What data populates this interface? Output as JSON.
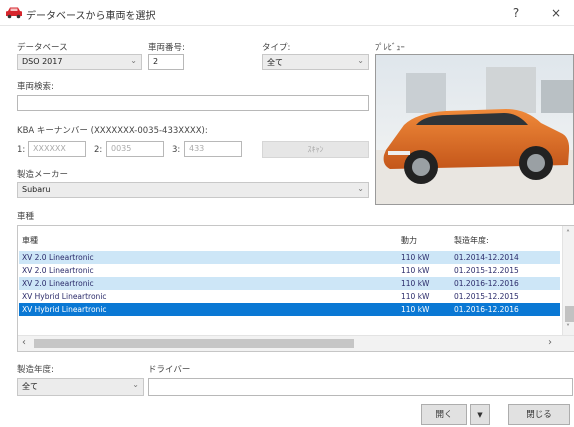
{
  "window": {
    "title": "データベースから車両を選択",
    "help_label": "?",
    "close_label": "×"
  },
  "form": {
    "database_label": "データベース",
    "database_value": "DSO 2017",
    "vehicle_no_label": "車両番号:",
    "vehicle_no_value": "2",
    "type_label": "タイプ:",
    "type_value": "全て",
    "search_label": "車両検索:",
    "search_value": "",
    "kba_label": "KBA キーナンバー (XXXXXXX-0035-433XXXX):",
    "kba_1_label": "1:",
    "kba_1_placeholder": "XXXXXX",
    "kba_2_label": "2:",
    "kba_2_value": "0035",
    "kba_3_label": "3:",
    "kba_3_value": "433",
    "kba_apply_label": "ｽｷｬﾝ",
    "manufacturer_label": "製造メーカー",
    "manufacturer_value": "Subaru",
    "preview_label": "ﾌﾟﾚﾋﾞｭｰ"
  },
  "models": {
    "section_label": "車種",
    "columns": [
      "車種",
      "動力",
      "製造年度:"
    ],
    "rows": [
      {
        "name": "XV 2.0 Lineartronic",
        "power": "110 kW",
        "years": "01.2014-12.2014",
        "state": "alt"
      },
      {
        "name": "XV 2.0 Lineartronic",
        "power": "110 kW",
        "years": "01.2015-12.2015",
        "state": "normal"
      },
      {
        "name": "XV 2.0 Lineartronic",
        "power": "110 kW",
        "years": "01.2016-12.2016",
        "state": "alt"
      },
      {
        "name": "XV Hybrid Lineartronic",
        "power": "110 kW",
        "years": "01.2015-12.2015",
        "state": "normal"
      },
      {
        "name": "XV Hybrid Lineartronic",
        "power": "110 kW",
        "years": "01.2016-12.2016",
        "state": "selected"
      }
    ]
  },
  "footer": {
    "year_label": "製造年度:",
    "year_value": "全て",
    "driver_label": "ドライバー",
    "driver_value": "",
    "open_label": "開く",
    "dropdown_arrow": "▼",
    "close_label": "閉じる"
  },
  "colors": {
    "selection": "#0a78d4",
    "alt_row": "#cde6f7",
    "brand_icon": "#d6262d"
  },
  "icons": {
    "title": "car-icon",
    "dropdown": "chevron-down-icon",
    "scroll_up": "chevron-up-icon",
    "scroll_down": "chevron-down-icon",
    "scroll_left": "chevron-left-icon",
    "scroll_right": "chevron-right-icon"
  }
}
